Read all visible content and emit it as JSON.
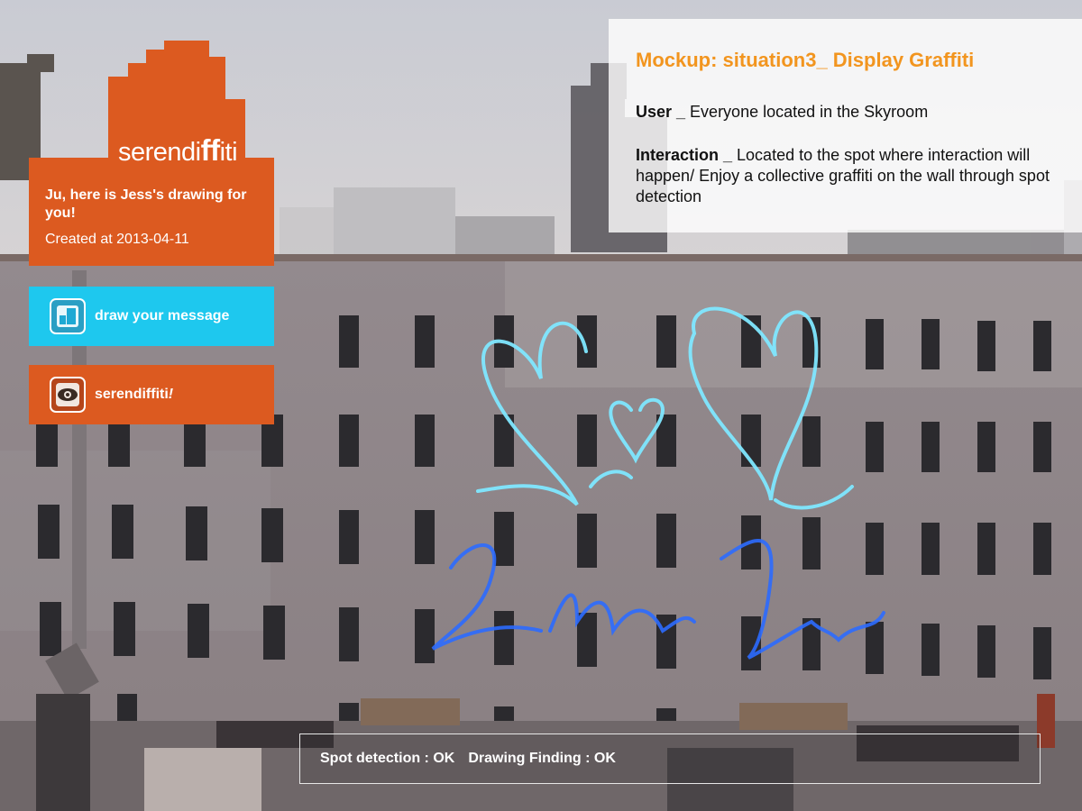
{
  "app": {
    "logo_prefix": "serendi",
    "logo_ff": "ff",
    "logo_suffix": "iti"
  },
  "message": {
    "headline": "Ju, here is Jess's drawing for you!",
    "created": "Created at 2013-04-11"
  },
  "buttons": {
    "draw_label": "draw your message",
    "serendiffiti_label": "serendiffiti",
    "serendiffiti_mark": "!"
  },
  "info_panel": {
    "title": "Mockup: situation3_ Display Graffiti",
    "user_key": "User _",
    "user_value": " Everyone located in the Skyroom",
    "interaction_key": "Interaction _",
    "interaction_value": " Located to the spot where interaction will happen/ Enjoy a collective graffiti on the wall through spot detection"
  },
  "status": {
    "spot": "Spot detection : OK",
    "drawing": "Drawing Finding : OK"
  },
  "colors": {
    "orange": "#dc5a20",
    "cyan": "#1ec8ee",
    "title_orange": "#f2951f"
  }
}
